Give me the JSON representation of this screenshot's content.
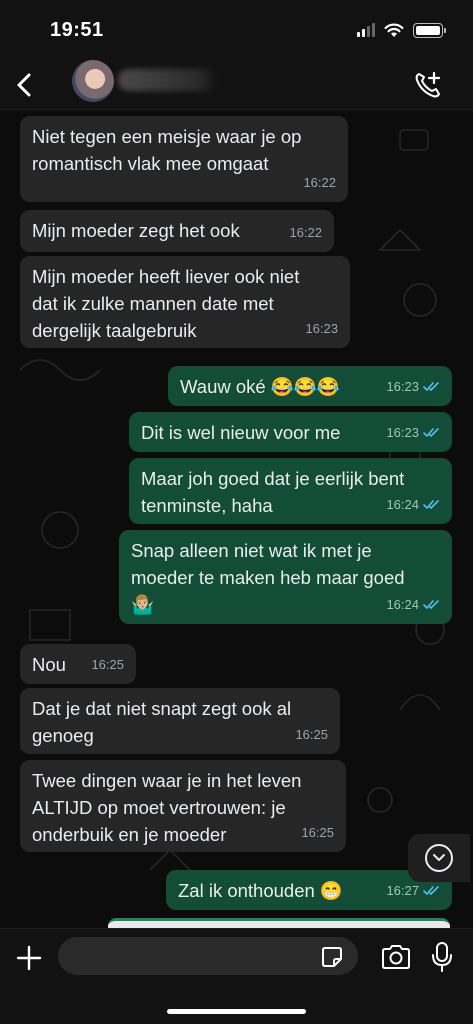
{
  "status_bar": {
    "time": "19:51"
  },
  "header": {
    "contact_name": "",
    "back_icon": "chevron-left-icon",
    "call_icon": "add-call-icon"
  },
  "messages": [
    {
      "dir": "in",
      "text": "Niet tegen een meisje waar je op\nromantisch vlak mee omgaat",
      "time": "16:22"
    },
    {
      "dir": "in",
      "text": "Mijn moeder zegt het ook",
      "time": "16:22"
    },
    {
      "dir": "in",
      "text": "Mijn moeder heeft liever ook niet\ndat ik zulke mannen date met\ndergelijk taalgebruik",
      "time": "16:23"
    },
    {
      "dir": "out",
      "text": "Wauw oké 😂😂😂",
      "time": "16:23",
      "read": true
    },
    {
      "dir": "out",
      "text": "Dit is wel nieuw voor me",
      "time": "16:23",
      "read": true
    },
    {
      "dir": "out",
      "text": "Maar joh goed dat je eerlijk bent\ntenminste, haha",
      "time": "16:24",
      "read": true
    },
    {
      "dir": "out",
      "text": "Snap alleen niet wat ik met je\nmoeder te maken heb maar goed\n🤷🏼‍♂️",
      "time": "16:24",
      "read": true
    },
    {
      "dir": "in",
      "text": "Nou",
      "time": "16:25"
    },
    {
      "dir": "in",
      "text": "Dat je dat niet snapt zegt ook al\ngenoeg",
      "time": "16:25"
    },
    {
      "dir": "in",
      "text": "Twee dingen waar je in het leven\nALTIJD op moet vertrouwen: je\nonderbuik en je moeder",
      "time": "16:25"
    },
    {
      "dir": "out",
      "text": "Zal ik onthouden 😁",
      "time": "16:27",
      "read": true
    }
  ],
  "composer": {
    "placeholder": "",
    "value": ""
  },
  "colors": {
    "incoming": "#262626",
    "outgoing": "#134d37",
    "read_ticks": "#53bdeb"
  }
}
